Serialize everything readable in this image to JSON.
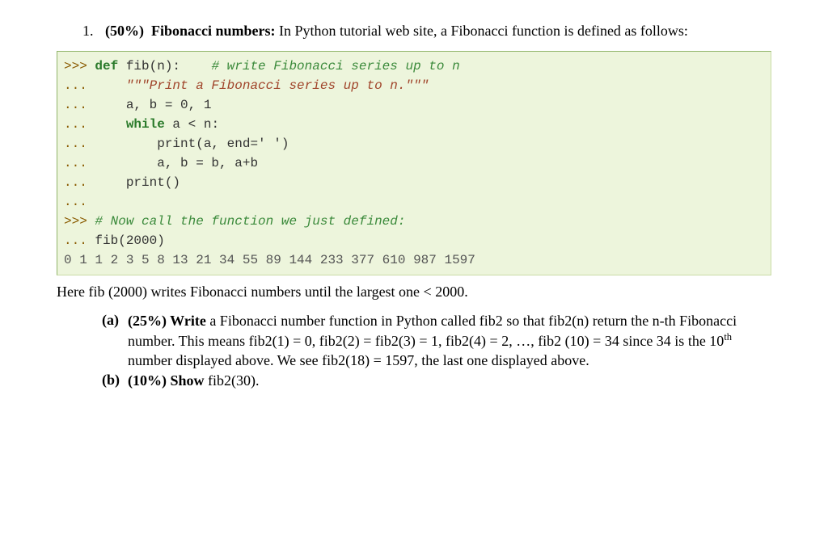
{
  "question": {
    "number": "1.",
    "weight": "(50%)",
    "title": "Fibonacci numbers:",
    "intro_rest": " In Python tutorial web site, a Fibonacci function is defined as follows:"
  },
  "code": {
    "p_gt": ">>> ",
    "p_dot": "... ",
    "def_kw": "def",
    "def_rest": " fib(n):    ",
    "def_cm": "# write Fibonacci series up to n",
    "docstring": "\"\"\"Print a Fibonacci series up to n.\"\"\"",
    "assign1": "a, b = 0, 1",
    "while_kw": "while",
    "while_cond": " a < n:",
    "print1": "print(a, end=' ')",
    "assign2": "a, b = b, a+b",
    "print2": "print()",
    "blank": "",
    "call_cm": "# Now call the function we just defined:",
    "call": "fib(2000)",
    "output": "0 1 1 2 3 5 8 13 21 34 55 89 144 233 377 610 987 1597"
  },
  "explain": "Here fib (2000) writes Fibonacci numbers until the largest one < 2000.",
  "parts": {
    "a": {
      "label": "(a)",
      "weight": "(25%) Write",
      "rest1": " a Fibonacci number function in Python called fib2 so that fib2(n) return the n-th Fibonacci number. This means fib2(1) = 0, fib2(2) = fib2(3) = 1, fib2(4) = 2, …, fib2 (10) = 34 since 34 is the 10",
      "sup": "th",
      "rest2": " number displayed above. We see fib2(18) = 1597, the last one displayed above."
    },
    "b": {
      "label": "(b)",
      "weight": "(10%) Show",
      "rest": " fib2(30)."
    }
  }
}
